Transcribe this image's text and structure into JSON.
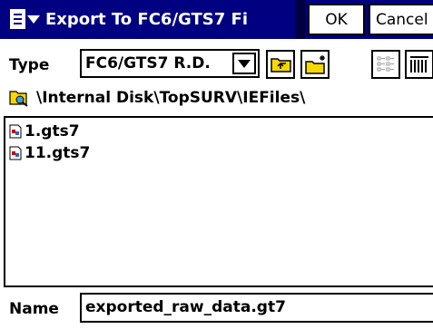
{
  "window": {
    "title": "Export To FC6/GTS7 Fi",
    "ok_label": "OK",
    "cancel_label": "Cancel"
  },
  "type": {
    "label": "Type",
    "selected": "FC6/GTS7 R.D."
  },
  "toolbar": {
    "icons": [
      "up-folder-icon",
      "new-folder-icon",
      "list-view-icon",
      "detail-view-icon"
    ]
  },
  "path": {
    "text": "\\Internal Disk\\TopSURV\\IEFiles\\"
  },
  "files": [
    {
      "name": "1.gts7"
    },
    {
      "name": "11.gts7"
    }
  ],
  "name_field": {
    "label": "Name",
    "value": "exported_raw_data.gt7"
  },
  "colors": {
    "titlebar": "#000080",
    "folder": "#f5d800",
    "accent_red": "#c00000"
  }
}
